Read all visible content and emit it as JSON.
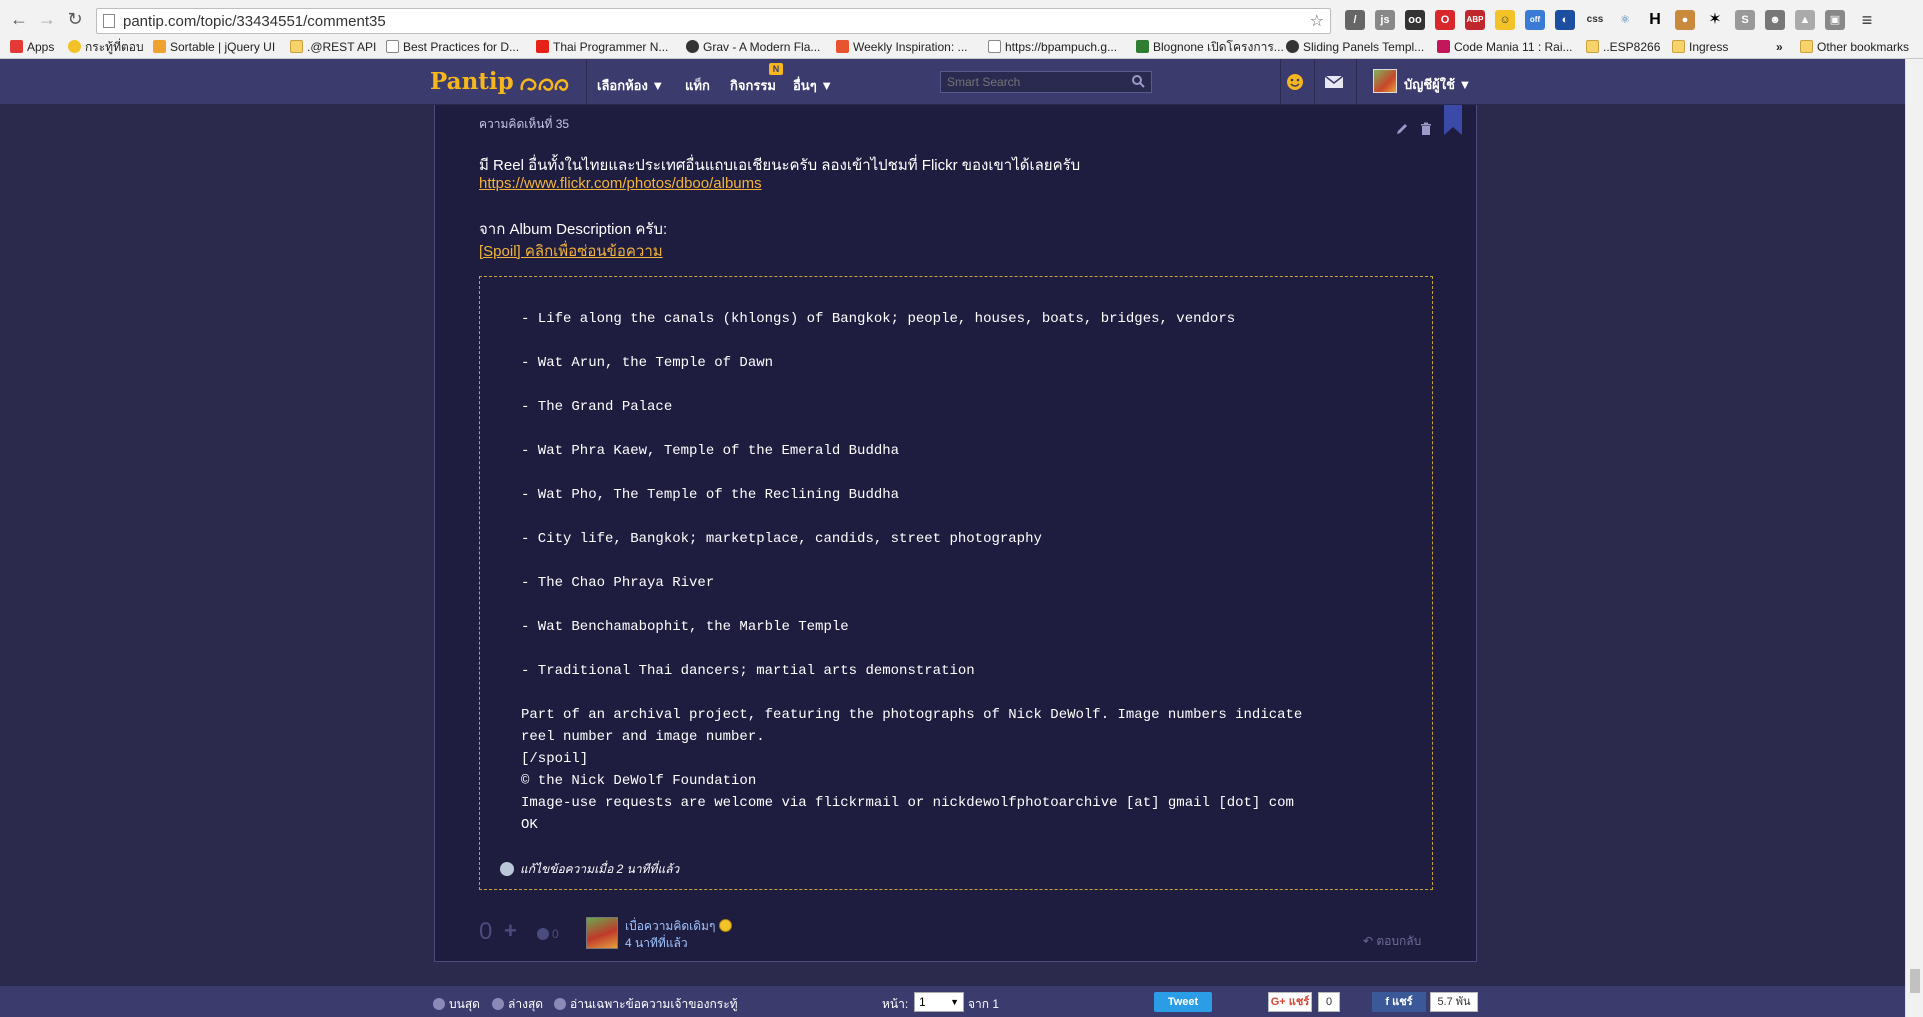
{
  "browser": {
    "url": "pantip.com/topic/33434551/comment35",
    "bookmarks": [
      {
        "label": "Apps",
        "icon": "apps-grid-icon"
      },
      {
        "label": "กระทู้ที่ตอบ",
        "icon": "smiley-icon"
      },
      {
        "label": "Sortable | jQuery UI",
        "icon": "jquery-icon"
      },
      {
        "label": ".@REST API",
        "icon": "folder-icon"
      },
      {
        "label": "Best Practices for D...",
        "icon": "page-icon"
      },
      {
        "label": "Thai Programmer N...",
        "icon": "youtube-icon"
      },
      {
        "label": "Grav - A Modern Fla...",
        "icon": "grav-icon"
      },
      {
        "label": "Weekly Inspiration: ...",
        "icon": "bookmark-icon"
      },
      {
        "label": "https://bpampuch.g...",
        "icon": "page-icon"
      },
      {
        "label": "Blognone เปิดโครงการ...",
        "icon": "blognone-icon"
      },
      {
        "label": "Sliding Panels Templ...",
        "icon": "codrops-icon"
      },
      {
        "label": "Code Mania 11 : Rai...",
        "icon": "codemania-icon"
      },
      {
        "label": "..ESP8266",
        "icon": "folder-icon"
      },
      {
        "label": "Ingress",
        "icon": "folder-icon"
      },
      {
        "label": "»",
        "icon": "overflow-icon"
      },
      {
        "label": "Other bookmarks",
        "icon": "folder-icon"
      }
    ]
  },
  "site": {
    "logo": "Pantip",
    "nav": [
      "เลือกห้อง ▼",
      "แท็ก",
      "กิจกรรม",
      "อื่นๆ ▼"
    ],
    "nav_badge": "N",
    "search_placeholder": "Smart Search",
    "account_label": "บัญชีผู้ใช้ ▼"
  },
  "comment": {
    "number_label": "ความคิดเห็นที่ 35",
    "line1": "มี Reel อื่นทั้งในไทยและประเทศอื่นแถบเอเชียนะครับ ลองเข้าไปชมที่ Flickr ของเขาได้เลยครับ",
    "link": "https://www.flickr.com/photos/dboo/albums",
    "line2": "จาก Album Description ครับ:",
    "spoil_label": "[Spoil] คลิกเพื่อซ่อนข้อความ",
    "spoil_lines": [
      "- Life along the canals (khlongs) of Bangkok; people, houses, boats, bridges, vendors",
      "- Wat Arun, the Temple of Dawn",
      "- The Grand Palace",
      "- Wat Phra Kaew, Temple of the Emerald Buddha",
      "- Wat Pho, The Temple of the Reclining Buddha",
      "- City life, Bangkok; marketplace, candids, street photography",
      "- The Chao Phraya River",
      "- Wat Benchamabophit, the Marble Temple",
      "- Traditional Thai dancers; martial arts demonstration"
    ],
    "spoil_tail": [
      "Part of an archival project, featuring the photographs of Nick DeWolf. Image numbers indicate",
      "reel number and image number.",
      "[/spoil]",
      "© the Nick DeWolf Foundation",
      "Image-use requests are welcome via flickrmail or nickdewolfphotoarchive [at] gmail [dot] com",
      "OK"
    ],
    "edited_note": "แก้ไขข้อความเมื่อ 2 นาทีที่แล้ว",
    "vote_count": "0",
    "emotion_count": "0",
    "author": "เบื่อความคิดเดิมๆ",
    "time": "4 นาทีที่แล้ว",
    "reply": "ตอบกลับ"
  },
  "footer": {
    "top": "บนสุด",
    "bottom": "ล่างสุด",
    "owner_only": "อ่านเฉพาะข้อความเจ้าของกระทู้",
    "page_label": "หน้า:",
    "page_value": "1",
    "page_of": "จาก 1",
    "tweet": "Tweet",
    "gplus": "แชร์",
    "gplus_count": "0",
    "fb_share": "แชร์",
    "fb_count": "5.7 พัน"
  },
  "colors": {
    "brand": "#f5b71d",
    "header_bg": "#3c3b6e",
    "page_bg": "#2b2a4c",
    "panel_bg": "#1f1d3f",
    "link": "#f2b43a"
  }
}
